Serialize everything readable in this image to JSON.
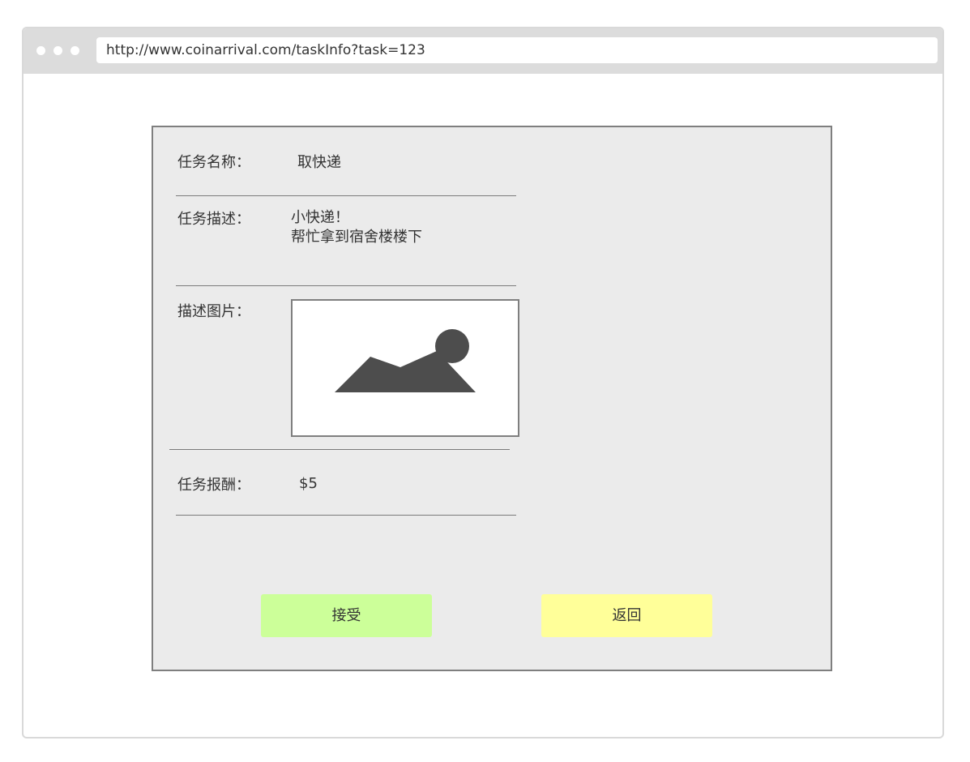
{
  "browser": {
    "url": "http://www.coinarrival.com/taskInfo?task=123",
    "window_dots": 3
  },
  "task": {
    "name_label": "任务名称：",
    "name_value": "取快递",
    "desc_label": "任务描述：",
    "desc_lines": [
      "小快递！",
      "帮忙拿到宿舍楼楼下"
    ],
    "image_label": "描述图片：",
    "image_icon": "image-placeholder-icon",
    "reward_label": "任务报酬：",
    "reward_value": "$5"
  },
  "actions": {
    "accept_label": "接受",
    "back_label": "返回"
  },
  "colors": {
    "panel_bg": "#ebebeb",
    "panel_border": "#7f7f7f",
    "accept_bg": "#ccff99",
    "back_bg": "#ffff99",
    "icon_fill": "#4d4d4d"
  }
}
